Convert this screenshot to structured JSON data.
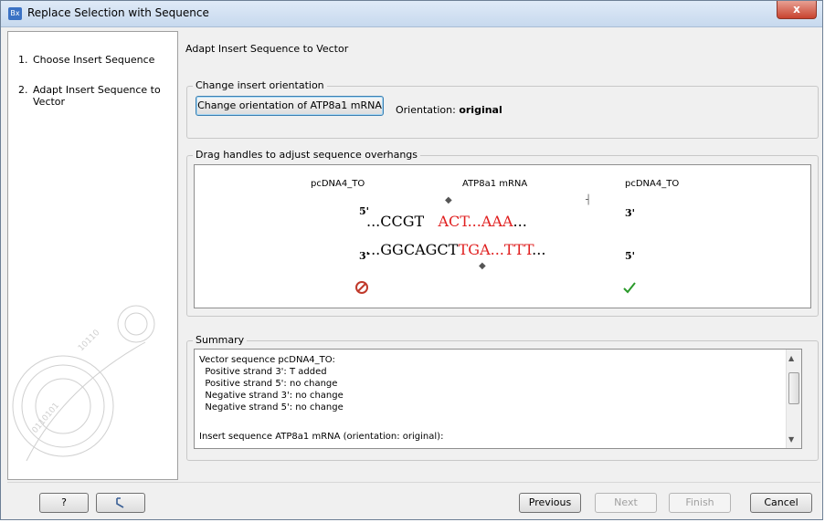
{
  "window": {
    "icon": "Bx",
    "title": "Replace Selection with Sequence",
    "close": "x"
  },
  "sidebar": {
    "items": [
      {
        "num": "1.",
        "label": "Choose Insert Sequence"
      },
      {
        "num": "2.",
        "label_line1": "Adapt Insert Sequence to",
        "label_line2": "Vector"
      }
    ]
  },
  "main": {
    "title": "Adapt Insert Sequence to Vector",
    "orientation_group": {
      "legend": "Change insert orientation",
      "button": "Change orientation of ATP8a1 mRNA",
      "orientation_label": "Orientation: ",
      "orientation_value": "original"
    },
    "overhang_group": {
      "legend": "Drag handles to adjust sequence overhangs",
      "left_vector": "pcDNA4_TO",
      "insert": "ATP8a1 mRNA",
      "right_vector": "pcDNA4_TO",
      "top_five": "5'",
      "top_three": "3'",
      "bottom_three": "3'",
      "bottom_five": "5'",
      "top_left_seq": "...CCGT",
      "top_red_seq": "ACT...AAA",
      "top_right_seq": "...",
      "bottom_left_seq": "...GGCAGCT",
      "bottom_red_seq": "TGA...TTT",
      "bottom_right_seq": "...",
      "status_left": "invalid-icon",
      "status_right": "checkmark-icon"
    },
    "summary_group": {
      "legend": "Summary",
      "lines": [
        "Vector sequence pcDNA4_TO:",
        "  Positive strand 3': T added",
        "  Positive strand 5': no change",
        "  Negative strand 3': no change",
        "  Negative strand 5': no change",
        "",
        "Insert sequence ATP8a1 mRNA (orientation: original):"
      ]
    }
  },
  "footer": {
    "help": "?",
    "previous": "Previous",
    "next": "Next",
    "finish": "Finish",
    "cancel": "Cancel"
  },
  "colors": {
    "accent_red": "#e02020",
    "check_green": "#2a9a2a",
    "invalid_red": "#c0392b"
  }
}
